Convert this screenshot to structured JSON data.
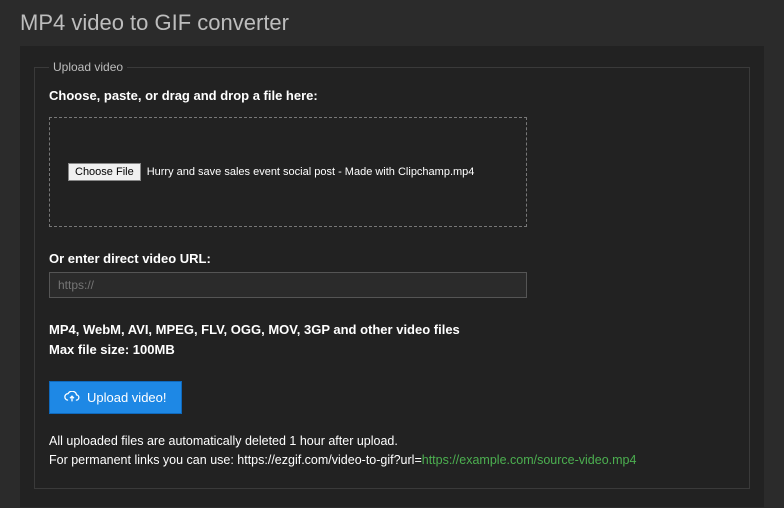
{
  "page": {
    "title": "MP4 video to GIF converter"
  },
  "upload": {
    "legend": "Upload video",
    "instruction": "Choose, paste, or drag and drop a file here:",
    "choose_button": "Choose File",
    "selected_file": "Hurry and save sales event social post - Made with Clipchamp.mp4",
    "url_label": "Or enter direct video URL:",
    "url_placeholder": "https://",
    "url_value": "",
    "formats_line": "MP4, WebM, AVI, MPEG, FLV, OGG, MOV, 3GP and other video files",
    "maxsize_line": "Max file size: 100MB",
    "button_label": "Upload video!",
    "note_deleted": "All uploaded files are automatically deleted 1 hour after upload.",
    "note_permalink_prefix": "For permanent links you can use: https://ezgif.com/video-to-gif?url=",
    "note_permalink_example": "https://example.com/source-video.mp4"
  }
}
